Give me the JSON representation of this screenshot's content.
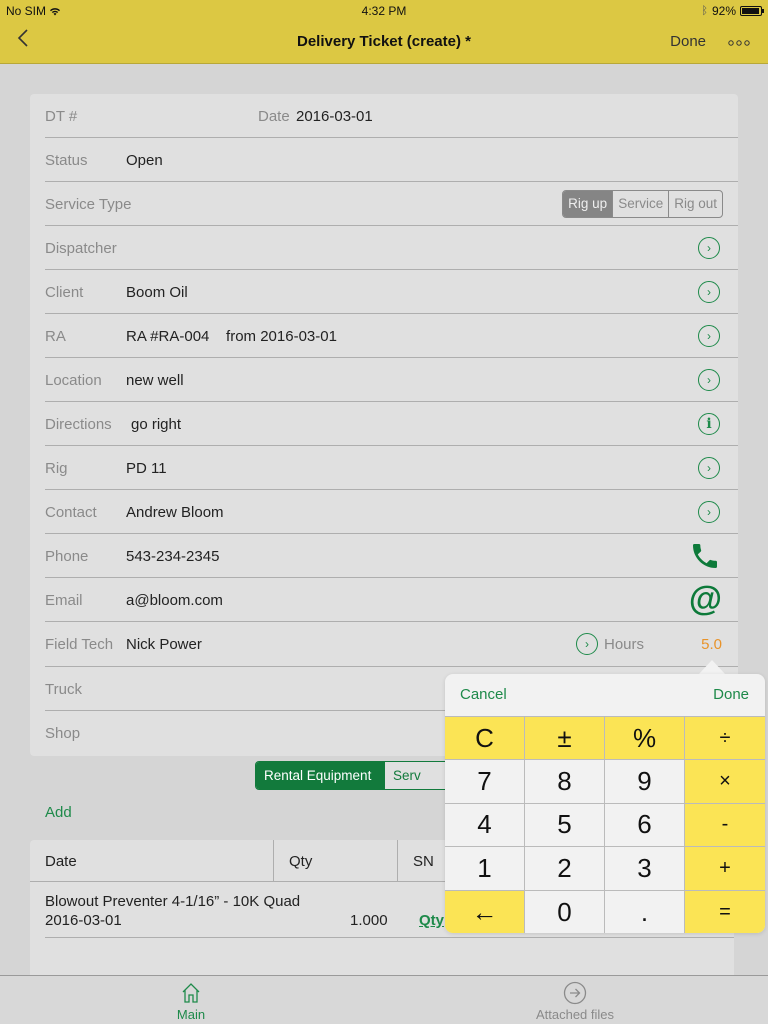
{
  "status_bar": {
    "carrier": "No SIM",
    "time": "4:32 PM",
    "battery": "92%",
    "battery_level": 0.92
  },
  "nav": {
    "title": "Delivery Ticket (create) *",
    "done_label": "Done",
    "more_label": "ooo"
  },
  "form": {
    "dt": {
      "label": "DT #",
      "date_label": "Date",
      "date_value": "2016-03-01"
    },
    "status": {
      "label": "Status",
      "value": "Open"
    },
    "service_type": {
      "label": "Service Type",
      "options": [
        "Rig up",
        "Service",
        "Rig out"
      ],
      "selected": "Rig up"
    },
    "dispatcher": {
      "label": "Dispatcher",
      "value": ""
    },
    "client": {
      "label": "Client",
      "value": "Boom Oil"
    },
    "ra": {
      "label": "RA",
      "value": "RA #RA-004    from 2016-03-01"
    },
    "location": {
      "label": "Location",
      "value": "new well"
    },
    "directions": {
      "label": "Directions",
      "value": "go right"
    },
    "rig": {
      "label": "Rig",
      "value": "PD 11"
    },
    "contact": {
      "label": "Contact",
      "value": "Andrew Bloom"
    },
    "phone": {
      "label": "Phone",
      "value": "543-234-2345"
    },
    "email": {
      "label": "Email",
      "value": "a@bloom.com"
    },
    "field_tech": {
      "label": "Field Tech",
      "value": "Nick Power",
      "hours_label": "Hours",
      "hours_value": "5.0"
    },
    "truck": {
      "label": "Truck",
      "value": ""
    },
    "shop": {
      "label": "Shop",
      "value": ""
    }
  },
  "tabs": {
    "items": [
      "Rental Equipment",
      "Serv"
    ],
    "selected": "Rental Equipment"
  },
  "add_label": "Add",
  "table": {
    "columns": [
      "Date",
      "Qty",
      "SN"
    ],
    "rows": [
      {
        "name": "Blowout Preventer 4-1/16” - 10K Quad",
        "date": "2016-03-01",
        "qty": "1.000",
        "link": "Qty"
      }
    ]
  },
  "calculator": {
    "cancel_label": "Cancel",
    "done_label": "Done",
    "keys": [
      "C",
      "±",
      "%",
      "÷",
      "7",
      "8",
      "9",
      "×",
      "4",
      "5",
      "6",
      "-",
      "1",
      "2",
      "3",
      "+",
      "←",
      "0",
      ".",
      "="
    ]
  },
  "tabbar": {
    "items": [
      {
        "label": "Main",
        "icon": "home-icon",
        "active": true
      },
      {
        "label": "Attached files",
        "icon": "arrow-circle-icon",
        "active": false
      }
    ]
  },
  "colors": {
    "nav_bg": "#dcc843",
    "accent_green": "#1e8a4a",
    "hours_orange": "#e8932a",
    "key_yellow": "#fbe455"
  }
}
